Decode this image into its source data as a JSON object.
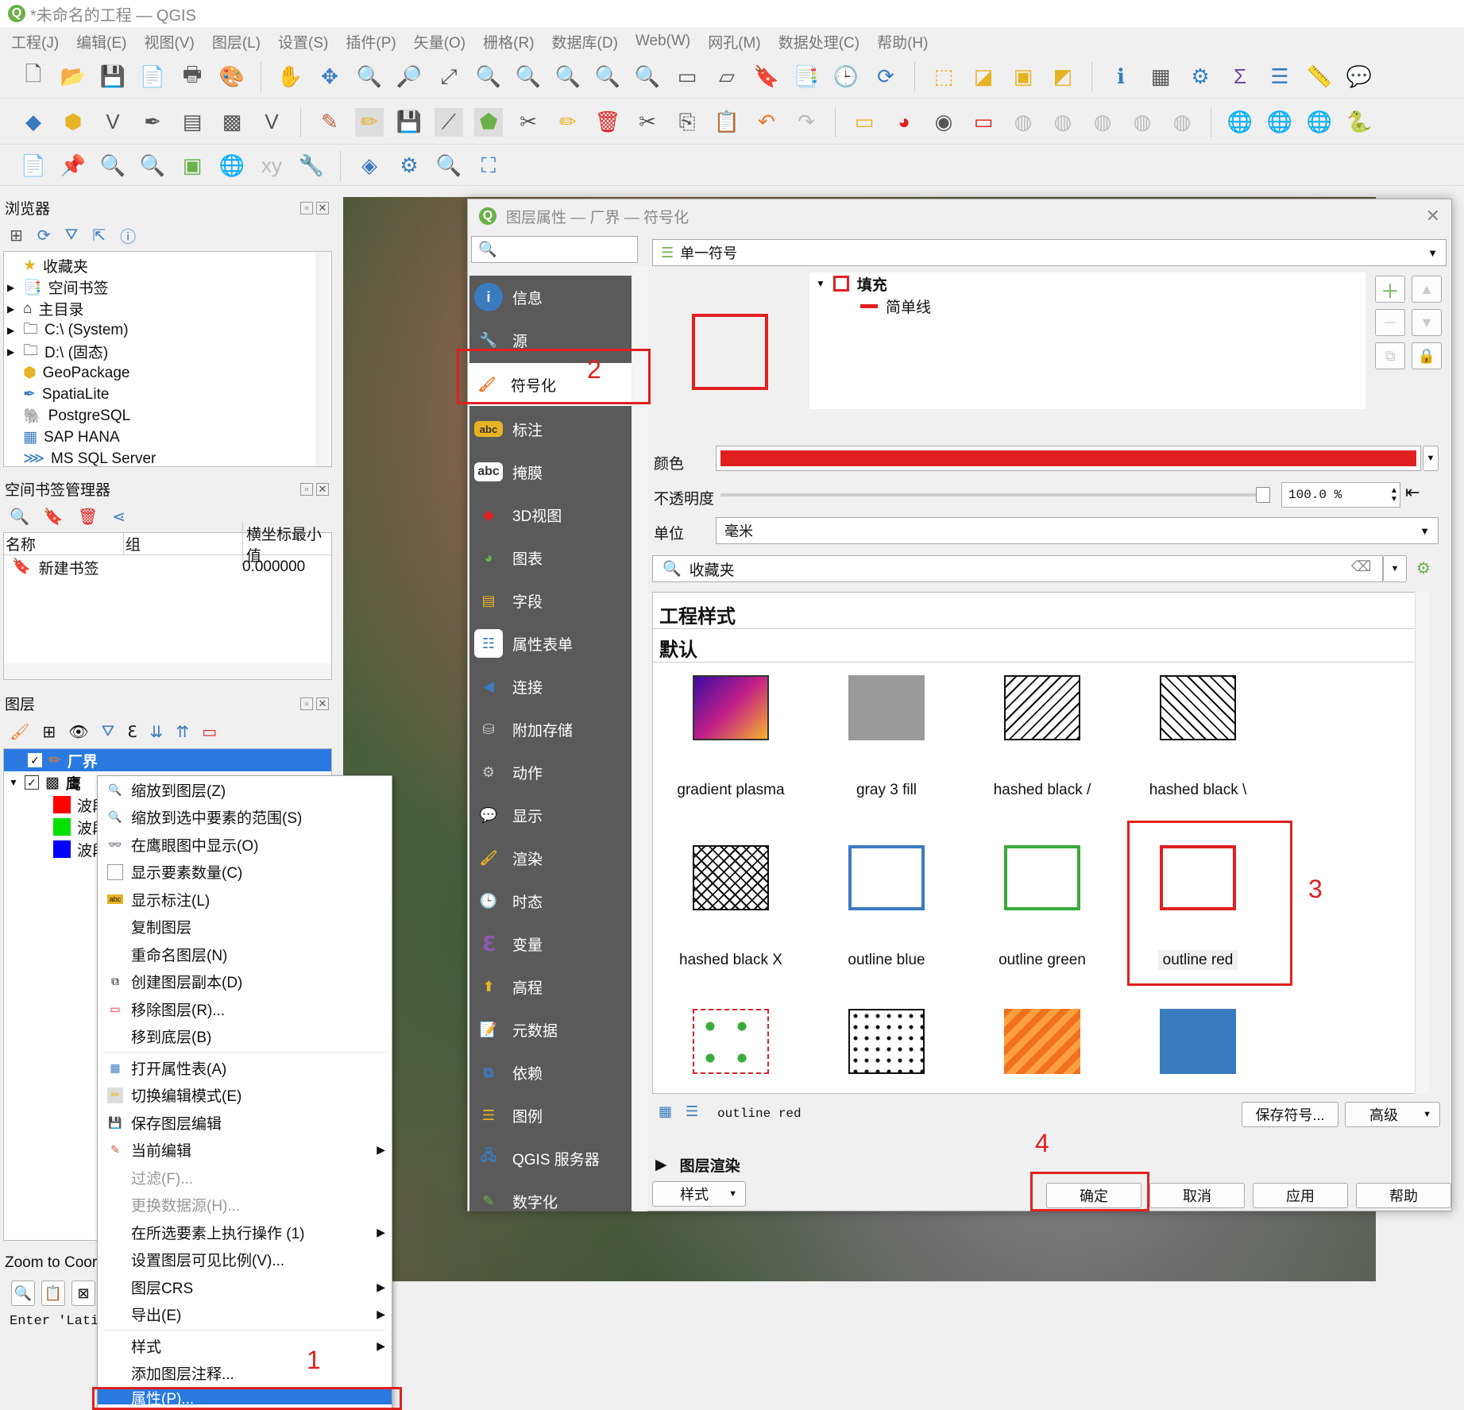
{
  "window": {
    "title": "*未命名的工程 — QGIS",
    "logo": "Q"
  },
  "menubar": [
    "工程(J)",
    "编辑(E)",
    "视图(V)",
    "图层(L)",
    "设置(S)",
    "插件(P)",
    "矢量(O)",
    "栅格(R)",
    "数据库(D)",
    "Web(W)",
    "网孔(M)",
    "数据处理(C)",
    "帮助(H)"
  ],
  "browser": {
    "title": "浏览器",
    "items": [
      "收藏夹",
      "空间书签",
      "主目录",
      "C:\\ (System)",
      "D:\\ (固态)",
      "GeoPackage",
      "SpatiaLite",
      "PostgreSQL",
      "SAP HANA",
      "MS SQL Server"
    ]
  },
  "bookmarks": {
    "title": "空间书签管理器",
    "col_name": "名称",
    "col_group": "组",
    "col_xmin": "横坐标最小值",
    "row_name": "新建书签",
    "row_xmin": "0.000000"
  },
  "layers": {
    "title": "图层",
    "layer1": "厂界",
    "layer2": "鹰",
    "band1": "波段",
    "band2": "波段",
    "band3": "波段"
  },
  "zoom": {
    "title": "Zoom to Coor",
    "enter": "Enter 'Latit"
  },
  "context_menu": [
    "缩放到图层(Z)",
    "缩放到选中要素的范围(S)",
    "在鹰眼图中显示(O)",
    "显示要素数量(C)",
    "显示标注(L)",
    "复制图层",
    "重命名图层(N)",
    "创建图层副本(D)",
    "移除图层(R)...",
    "移到底层(B)",
    "打开属性表(A)",
    "切换编辑模式(E)",
    "保存图层编辑",
    "当前编辑",
    "过滤(F)...",
    "更换数据源(H)...",
    "在所选要素上执行操作 (1)",
    "设置图层可见比例(V)...",
    "图层CRS",
    "导出(E)",
    "样式",
    "添加图层注释...",
    "属性(P)..."
  ],
  "dialog": {
    "title": "图层属性 — 厂界 — 符号化",
    "nav": [
      "信息",
      "源",
      "符号化",
      "标注",
      "掩膜",
      "3D视图",
      "图表",
      "字段",
      "属性表单",
      "连接",
      "附加存储",
      "动作",
      "显示",
      "渲染",
      "时态",
      "变量",
      "高程",
      "元数据",
      "依赖",
      "图例",
      "QGIS 服务器",
      "数字化"
    ],
    "renderer": "单一符号",
    "tree_fill": "填充",
    "tree_line": "简单线",
    "color_label": "颜色",
    "opacity_label": "不透明度",
    "opacity_value": "100.0 %",
    "unit_label": "单位",
    "unit_value": "毫米",
    "search_value": "收藏夹",
    "section1": "工程样式",
    "section2": "默认",
    "symbols": [
      "gradient  plasma",
      "gray 3 fill",
      "hashed black /",
      "hashed black \\",
      "hashed black X",
      "outline blue",
      "outline green",
      "outline red"
    ],
    "selected_symbol": "outline red",
    "save_symbol": "保存符号...",
    "advanced": "高级",
    "layer_render": "图层渲染",
    "style": "样式",
    "ok": "确定",
    "cancel": "取消",
    "apply": "应用",
    "help": "帮助"
  },
  "annotations": {
    "a1": "1",
    "a2": "2",
    "a3": "3",
    "a4": "4"
  },
  "colors": {
    "red": "#e02020",
    "blue": "#3a7bbf",
    "green": "#3aaa3a",
    "nav": "#5a5a5a"
  }
}
